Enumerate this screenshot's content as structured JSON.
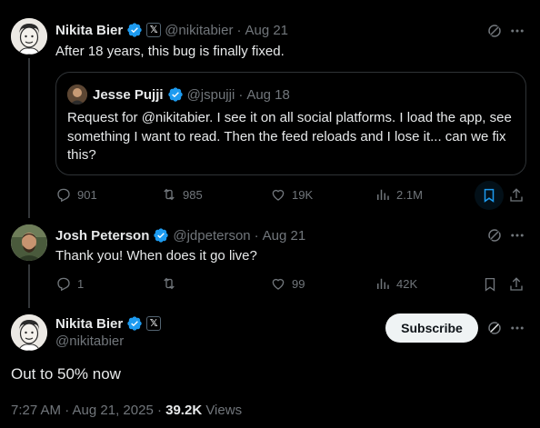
{
  "tweet1": {
    "name": "Nikita Bier",
    "handle": "@nikitabier",
    "date": "Aug 21",
    "text": "After 18 years, this bug is finally fixed.",
    "quote": {
      "name": "Jesse Pujji",
      "handle": "@jspujji",
      "date": "Aug 18",
      "text": "Request for @nikitabier. I see it on all social platforms. I load the app, see something I want to read. Then the feed reloads and I lose it... can we fix this?"
    },
    "actions": {
      "replies": "901",
      "retweets": "985",
      "likes": "19K",
      "views": "2.1M"
    }
  },
  "tweet2": {
    "name": "Josh Peterson",
    "handle": "@jdpeterson",
    "date": "Aug 21",
    "text": "Thank you! When does it go live?",
    "actions": {
      "replies": "1",
      "retweets": "",
      "likes": "99",
      "views": "42K"
    }
  },
  "main": {
    "name": "Nikita Bier",
    "handle": "@nikitabier",
    "subscribe_label": "Subscribe",
    "text": "Out to 50% now",
    "timestamp": "7:27 AM · Aug 21, 2025 ·",
    "views_count": "39.2K",
    "views_label": "Views"
  },
  "separator": "·",
  "x_badge": "𝕏",
  "colors": {
    "verified": "#1d9bf0",
    "muted": "#71767b",
    "bookmark_active": "#1d9bf0"
  }
}
